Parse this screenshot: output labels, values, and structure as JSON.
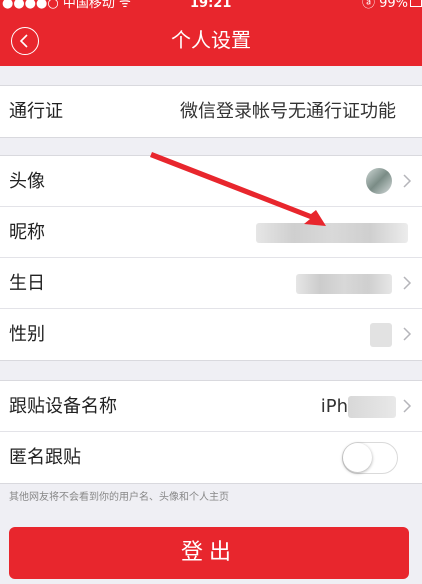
{
  "status_bar": {
    "carrier": "●●●●○ 中国移动 ᯤ",
    "time": "19:21",
    "battery": "ⓐ 99%"
  },
  "nav": {
    "title": "个人设置"
  },
  "pass_row": {
    "label": "通行证",
    "value": "微信登录帐号无通行证功能"
  },
  "profile_rows": [
    {
      "label": "头像"
    },
    {
      "label": "昵称"
    },
    {
      "label": "生日"
    },
    {
      "label": "性别"
    }
  ],
  "device_rows": [
    {
      "label": "跟贴设备名称",
      "value": "iPh"
    },
    {
      "label": "匿名跟贴",
      "toggle_on": false
    }
  ],
  "hint": "其他网友将不会看到你的用户名、头像和个人主页",
  "logout_label": "登出",
  "colors": {
    "brand_red": "#e8262d",
    "annotation_red": "#e8262d"
  }
}
